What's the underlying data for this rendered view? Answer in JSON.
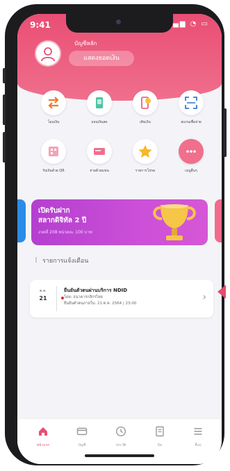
{
  "status_bar": {
    "time": "9:41",
    "icons": "▂▄▆ ◔ ▭"
  },
  "header": {
    "account_label": "บัญชีหลัก",
    "show_balance": "แสดงยอดเงิน"
  },
  "menu": [
    {
      "label": "โอนเงิน",
      "icon": "transfer-icon"
    },
    {
      "label": "ถอนเงินสด",
      "icon": "cash-withdraw-icon"
    },
    {
      "label": "เติมเงิน",
      "icon": "topup-icon"
    },
    {
      "label": "สแกนเพื่อจ่าย",
      "icon": "scan-icon"
    },
    {
      "label": "รับเงินด้วย QR",
      "icon": "qr-receive-icon"
    },
    {
      "label": "จ่ายด้วยแขน",
      "icon": "bill-pay-icon"
    },
    {
      "label": "รายการโปรด",
      "icon": "star-icon"
    },
    {
      "label": "เมนูอื่นๆ",
      "icon": "more-icon"
    }
  ],
  "banner": {
    "line1": "เปิดรับฝาก",
    "line2": "สลากดิจิทัล 2 ปี",
    "line3": "งวดที่ 208 หน่วยละ 100 บาท"
  },
  "notifications": {
    "section_title": "รายการแจ้งเตือน",
    "items": [
      {
        "month": "ต.ค.",
        "day": "21",
        "title": "ยืนยันตัวตนผ่านบริการ NDID",
        "line2": "โดย: ธนาคารกสิกรไทย",
        "line3": "ยืนยันตัวตนภายใน: 21 ต.ค. 2564 | 23:00"
      }
    ]
  },
  "tabbar": [
    {
      "label": "หน้าแรก",
      "icon": "home-icon",
      "active": true
    },
    {
      "label": "บัญชี",
      "icon": "card-icon",
      "active": false
    },
    {
      "label": "ประวัติ",
      "icon": "clock-icon",
      "active": false
    },
    {
      "label": "บิล",
      "icon": "document-icon",
      "active": false
    },
    {
      "label": "อื่นๆ",
      "icon": "menu-icon",
      "active": false
    }
  ],
  "colors": {
    "accent": "#e94e74",
    "banner": "#c44ad6",
    "left_card": "#2b8ce8"
  }
}
